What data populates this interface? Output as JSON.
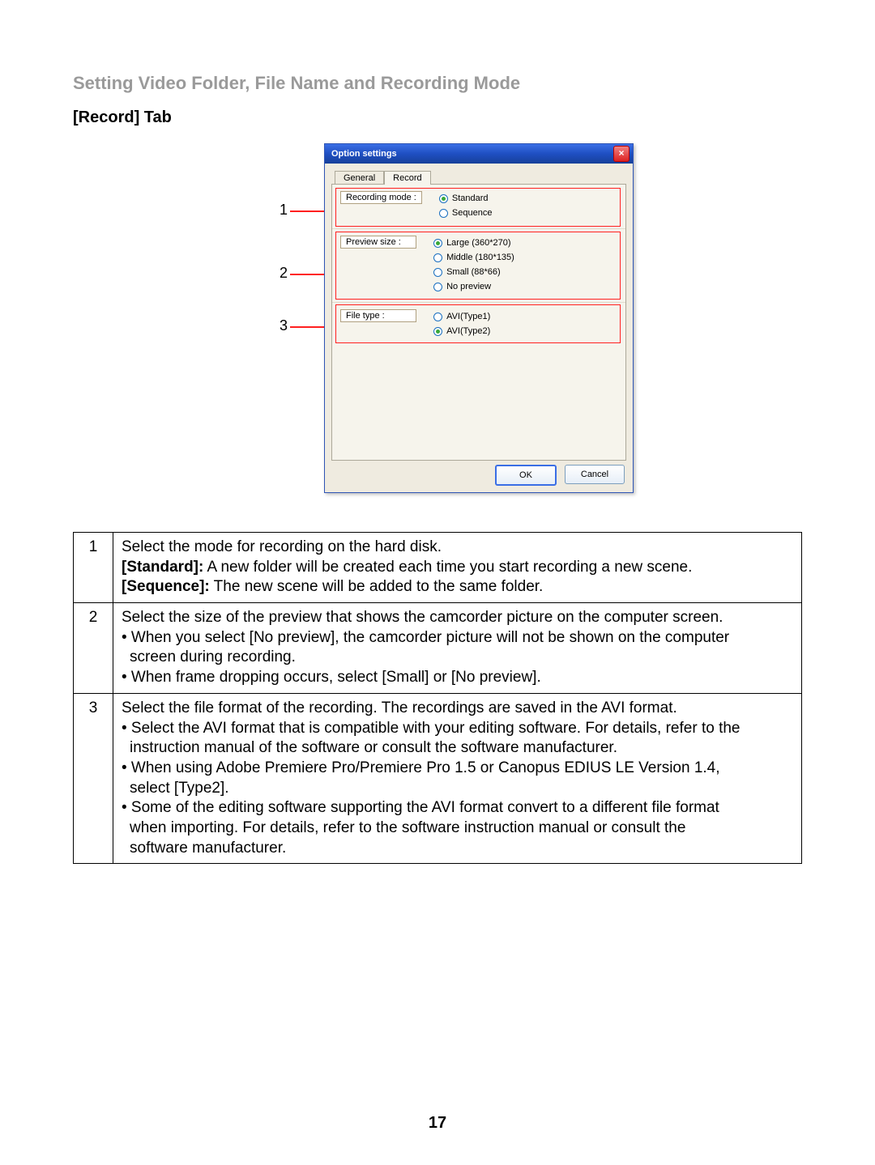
{
  "section_title": "Setting Video Folder, File Name and Recording Mode",
  "subsection_title": "[Record] Tab",
  "page_number": "17",
  "dialog": {
    "title": "Option settings",
    "tabs": {
      "general": "General",
      "record": "Record"
    },
    "groups": {
      "recording_mode": {
        "label": "Recording mode :",
        "options": {
          "standard": "Standard",
          "sequence": "Sequence"
        }
      },
      "preview_size": {
        "label": "Preview size :",
        "options": {
          "large": "Large (360*270)",
          "middle": "Middle (180*135)",
          "small": "Small (88*66)",
          "none": "No preview"
        }
      },
      "file_type": {
        "label": "File type :",
        "options": {
          "type1": "AVI(Type1)",
          "type2": "AVI(Type2)"
        }
      }
    },
    "buttons": {
      "ok": "OK",
      "cancel": "Cancel"
    }
  },
  "callouts": {
    "c1": "1",
    "c2": "2",
    "c3": "3"
  },
  "table": {
    "row1": {
      "num": "1",
      "line1": "Select the mode for recording on the hard disk.",
      "std_lbl": "[Standard]:",
      "std_txt": " A new folder will be created each time you start recording a new scene.",
      "seq_lbl": "[Sequence]:",
      "seq_txt": " The new scene will be added to the same folder."
    },
    "row2": {
      "num": "2",
      "line1": "Select the size of the preview that shows the camcorder picture on the computer screen.",
      "b1a": "• When you select [No preview], the camcorder picture will not be shown on the computer",
      "b1b": "screen during recording.",
      "b2": "• When frame dropping occurs, select [Small] or [No preview]."
    },
    "row3": {
      "num": "3",
      "line1": "Select the file format of the recording. The recordings are saved in the AVI format.",
      "b1a": "• Select the AVI format that is compatible with your editing software. For details, refer to the",
      "b1b": "instruction manual of the software or consult the software manufacturer.",
      "b2a": "• When using Adobe Premiere Pro/Premiere Pro 1.5 or Canopus EDIUS LE Version 1.4,",
      "b2b": "select [Type2].",
      "b3a": "• Some of the editing software supporting the AVI format convert to a different file format",
      "b3b": "when importing. For details, refer to the software instruction manual or consult the",
      "b3c": "software manufacturer."
    }
  }
}
